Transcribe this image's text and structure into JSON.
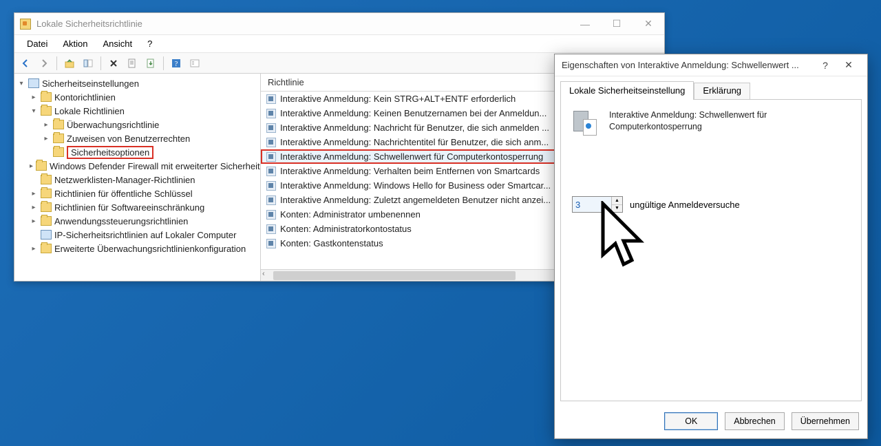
{
  "mmc": {
    "title": "Lokale Sicherheitsrichtlinie",
    "menu": {
      "datei": "Datei",
      "aktion": "Aktion",
      "ansicht": "Ansicht",
      "help": "?"
    },
    "list_header": "Richtlinie",
    "tree": {
      "root": "Sicherheitseinstellungen",
      "konto": "Kontorichtlinien",
      "lokale": "Lokale Richtlinien",
      "ueberw": "Überwachungsrichtlinie",
      "zuweis": "Zuweisen von Benutzerrechten",
      "sichopt": "Sicherheitsoptionen",
      "wdf": "Windows Defender Firewall mit erweiterter Sicherheit",
      "netz": "Netzwerklisten-Manager-Richtlinien",
      "oeff": "Richtlinien für öffentliche Schlüssel",
      "swe": "Richtlinien für Softwareeinschränkung",
      "anw": "Anwendungssteuerungsrichtlinien",
      "ipsec": "IP-Sicherheitsrichtlinien auf Lokaler Computer",
      "erw": "Erweiterte Überwachungsrichtlinienkonfiguration"
    },
    "policies": [
      "Interaktive Anmeldung: Kein STRG+ALT+ENTF erforderlich",
      "Interaktive Anmeldung: Keinen Benutzernamen bei der Anmeldun...",
      "Interaktive Anmeldung: Nachricht für Benutzer, die sich anmelden ...",
      "Interaktive Anmeldung: Nachrichtentitel für Benutzer, die sich anm...",
      "Interaktive Anmeldung: Schwellenwert für Computerkontosperrung",
      "Interaktive Anmeldung: Verhalten beim Entfernen von Smartcards",
      "Interaktive Anmeldung: Windows Hello for Business oder Smartcar...",
      "Interaktive Anmeldung: Zuletzt angemeldeten Benutzer nicht anzei...",
      "Konten: Administrator umbenennen",
      "Konten: Administratorkontostatus",
      "Konten: Gastkontenstatus"
    ],
    "selected_policy_index": 4
  },
  "dialog": {
    "title": "Eigenschaften von Interaktive Anmeldung: Schwellenwert ...",
    "tab_local": "Lokale Sicherheitseinstellung",
    "tab_explain": "Erklärung",
    "policy_name": "Interaktive Anmeldung: Schwellenwert für Computerkontosperrung",
    "spin_value": "3",
    "spin_label": "ungültige Anmeldeversuche",
    "ok": "OK",
    "cancel": "Abbrechen",
    "apply": "Übernehmen"
  }
}
